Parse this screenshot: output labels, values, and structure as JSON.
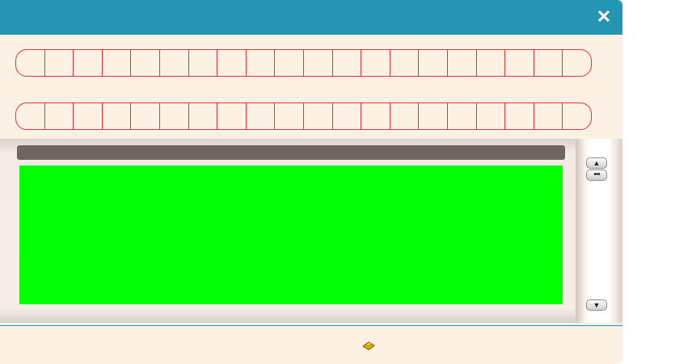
{
  "window": {
    "close_icon": "close-icon",
    "close_glyph": "✕",
    "accent_color": "#2595b4"
  },
  "slot_rows": [
    {
      "name": "slot-row-1",
      "slot_count": 20
    },
    {
      "name": "slot-row-2",
      "slot_count": 20
    }
  ],
  "panel": {
    "header_bar_color": "#6e6660",
    "content_color": "#00ff00"
  },
  "scrollbar": {
    "up_glyph": "▲",
    "thumb_glyph": "•••",
    "down_glyph": "▼"
  },
  "footer": {
    "icon": "gold-bar-icon"
  }
}
